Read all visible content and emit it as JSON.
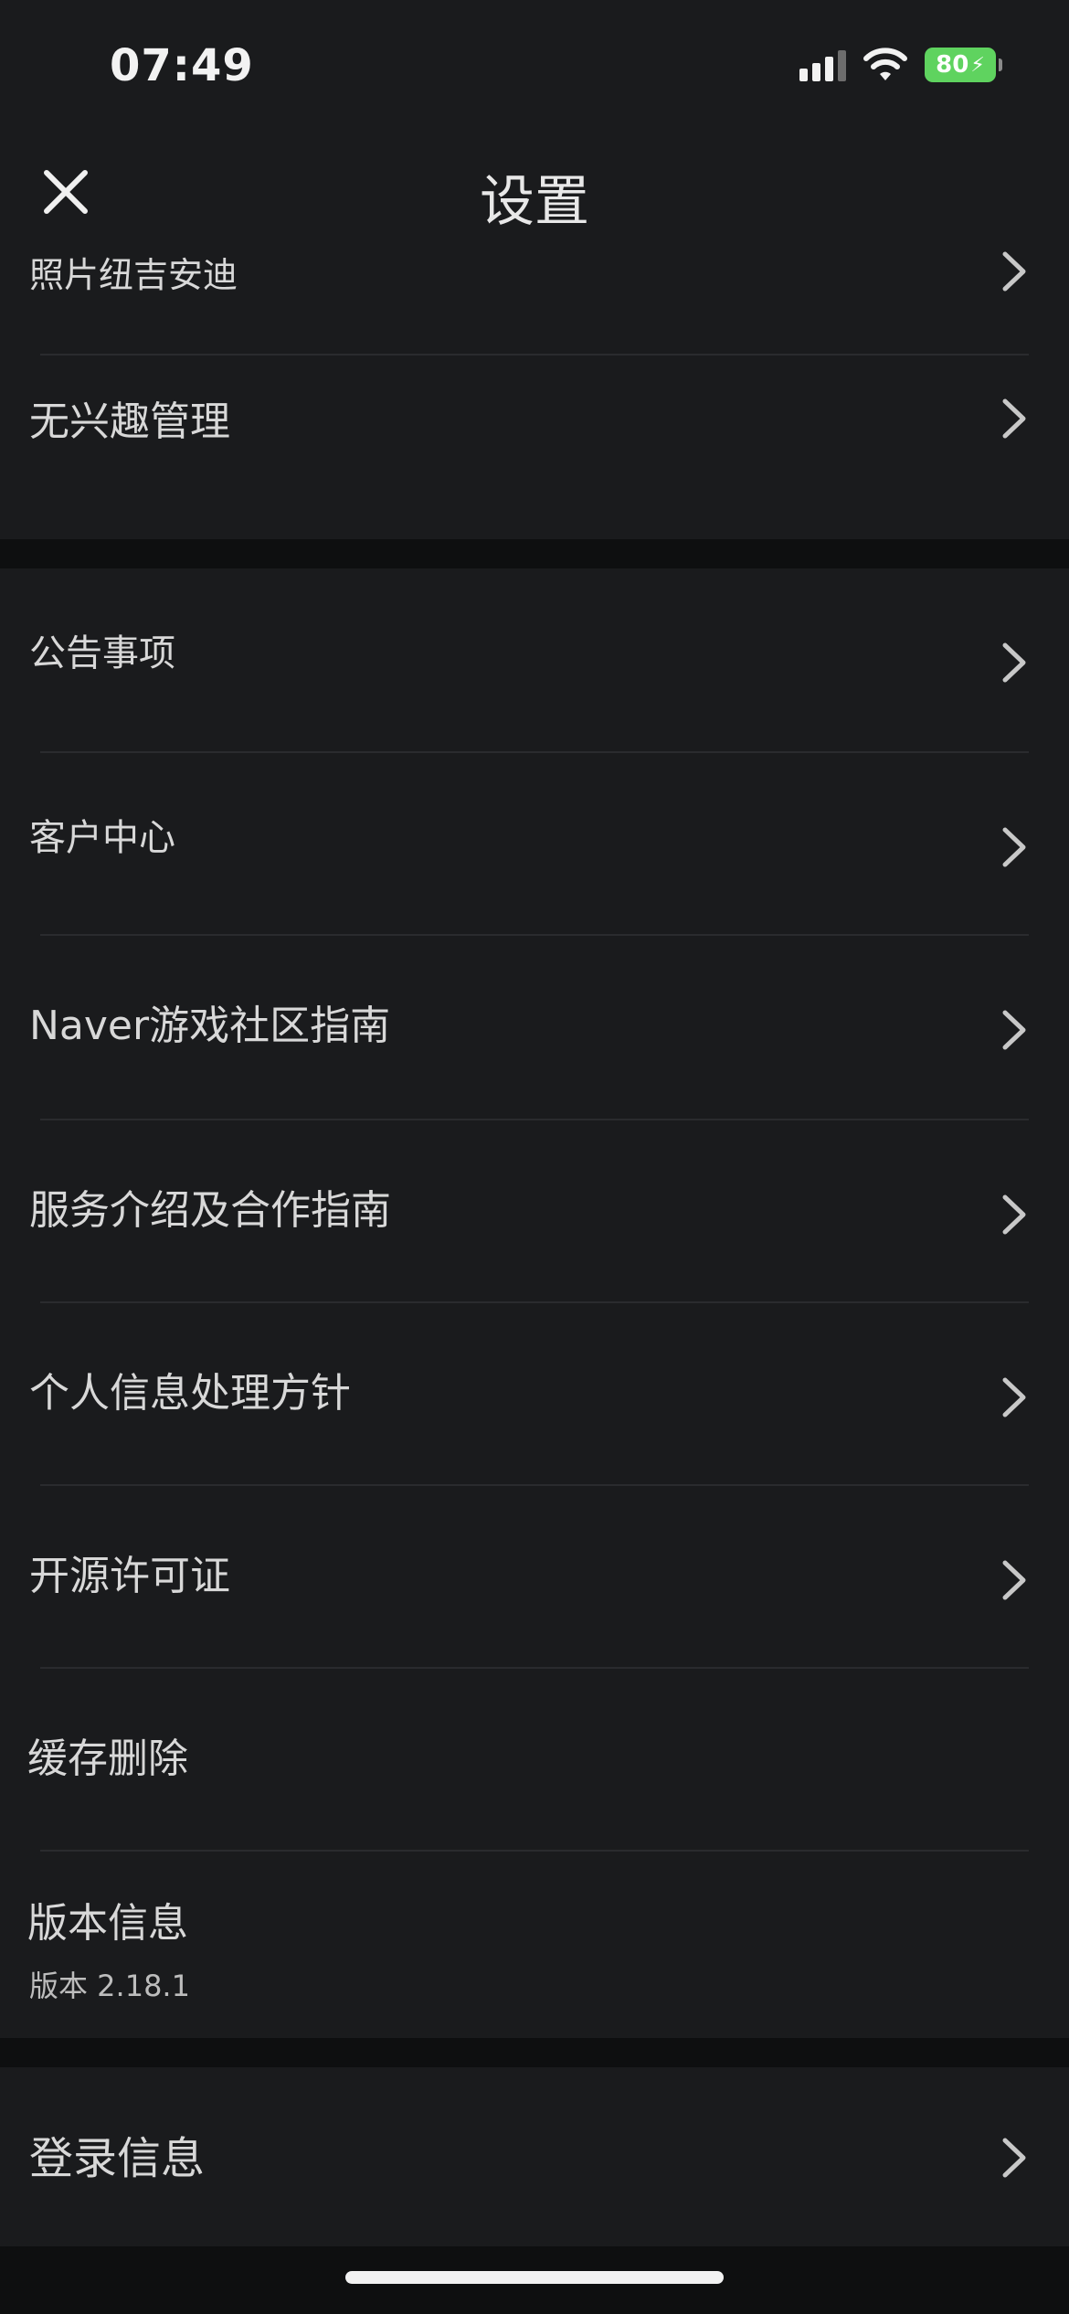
{
  "status_bar": {
    "time": "07:49",
    "battery": "80"
  },
  "header": {
    "title": "设置",
    "close_icon": "close-icon"
  },
  "sections": [
    {
      "items": [
        {
          "label": "照片纽吉安迪",
          "has_chevron": true
        },
        {
          "label": "无兴趣管理",
          "has_chevron": true
        }
      ]
    },
    {
      "items": [
        {
          "label": "公告事项",
          "has_chevron": true
        },
        {
          "label": "客户中心",
          "has_chevron": true
        },
        {
          "label": "Naver游戏社区指南",
          "has_chevron": true
        },
        {
          "label": "服务介绍及合作指南",
          "has_chevron": true
        },
        {
          "label": "个人信息处理方针",
          "has_chevron": true
        },
        {
          "label": "开源许可证",
          "has_chevron": true
        },
        {
          "label": "缓存删除",
          "has_chevron": false
        },
        {
          "label": "版本信息",
          "sublabel": "版本 2.18.1",
          "has_chevron": false
        }
      ]
    },
    {
      "items": [
        {
          "label": "登录信息",
          "has_chevron": true
        }
      ]
    }
  ],
  "colors": {
    "background": "#0e0f10",
    "card": "#1a1b1d",
    "divider": "#2a2b2e",
    "text": "#d8d8d8",
    "battery": "#5fd35f"
  }
}
